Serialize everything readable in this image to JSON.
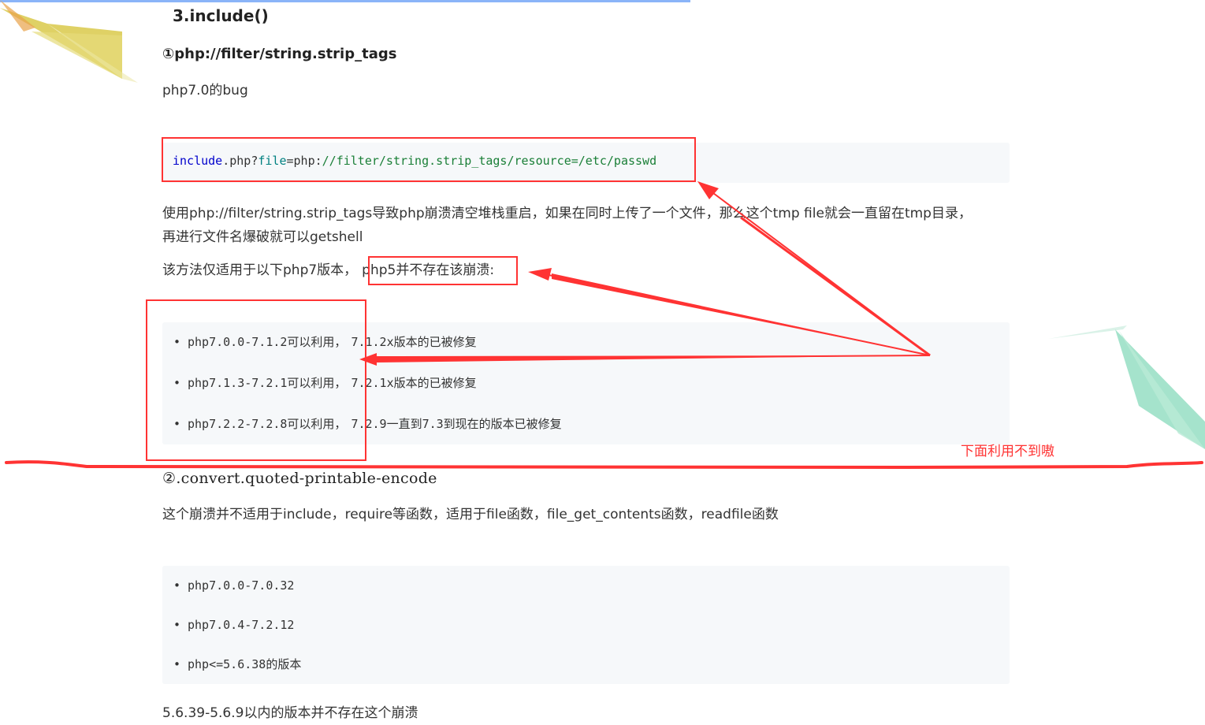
{
  "section_title": "3.include()",
  "method1": {
    "heading": "①php://filter/string.strip_tags",
    "note": "php7.0的bug",
    "code": {
      "kw": "include",
      "plain1": ".php?",
      "attr": "file",
      "eq": "=",
      "scheme": "php:",
      "path": "//filter/string.strip_tags/resource=/etc/passwd"
    },
    "desc_line1": "使用php://filter/string.strip_tags导致php崩溃清空堆栈重启，如果在同时上传了一个文件，那么这个tmp file就会一直留在tmp目录，",
    "desc_line2": "再进行文件名爆破就可以getshell",
    "applies_prefix": "该方法仅适用于以下php7版本，",
    "applies_highlight": "php5并不存在该崩溃:",
    "versions": [
      {
        "range": "php7.0.0-7.1.2可以利用，",
        "fix": "7.1.2x版本的已被修复"
      },
      {
        "range": "php7.1.3-7.2.1可以利用，",
        "fix": "7.2.1x版本的已被修复"
      },
      {
        "range": "php7.2.2-7.2.8可以利用，",
        "fix": "7.2.9一直到7.3到现在的版本已被修复"
      }
    ]
  },
  "annotation": "下面利用不到嗷",
  "method2": {
    "heading": "②.convert.quoted-printable-encode",
    "desc": "这个崩溃并不适用于include，require等函数，适用于file函数，file_get_contents函数，readfile函数",
    "versions": [
      "php7.0.0-7.0.32",
      "php7.0.4-7.2.12",
      "php<=5.6.38的版本"
    ],
    "footer": "5.6.39-5.6.9以内的版本并不存在这个崩溃"
  },
  "colors": {
    "annotation_red": "#ff3333",
    "code_bg": "#f6f8fa",
    "top_bar": "#8ab4f8"
  }
}
